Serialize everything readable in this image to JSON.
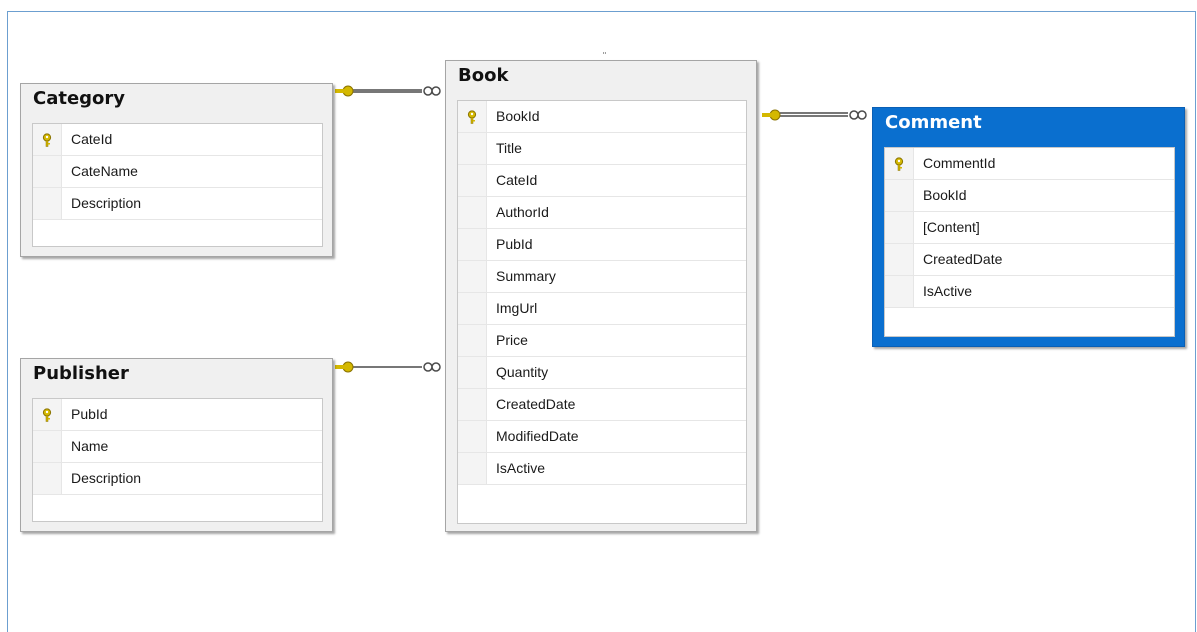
{
  "tables": {
    "category": {
      "name": "Category",
      "columns": [
        "CateId",
        "CateName",
        "Description"
      ],
      "pk": "CateId"
    },
    "publisher": {
      "name": "Publisher",
      "columns": [
        "PubId",
        "Name",
        "Description"
      ],
      "pk": "PubId"
    },
    "book": {
      "name": "Book",
      "columns": [
        "BookId",
        "Title",
        "CateId",
        "AuthorId",
        "PubId",
        "Summary",
        "ImgUrl",
        "Price",
        "Quantity",
        "CreatedDate",
        "ModifiedDate",
        "IsActive"
      ],
      "pk": "BookId"
    },
    "comment": {
      "name": "Comment",
      "columns": [
        "CommentId",
        "BookId",
        "[Content]",
        "CreatedDate",
        "IsActive"
      ],
      "pk": "CommentId",
      "selected": true
    }
  },
  "colors": {
    "key": "#d4b800",
    "link": "#4a4a4a",
    "selection": "#0a6fcf"
  },
  "relationships": [
    {
      "from": "Category",
      "to": "Book",
      "one_icon": "key-icon",
      "many_icon": "infinity-icon"
    },
    {
      "from": "Publisher",
      "to": "Book",
      "one_icon": "key-icon",
      "many_icon": "infinity-icon"
    },
    {
      "from": "Book",
      "to": "Comment",
      "one_icon": "key-icon",
      "many_icon": "infinity-icon"
    }
  ]
}
